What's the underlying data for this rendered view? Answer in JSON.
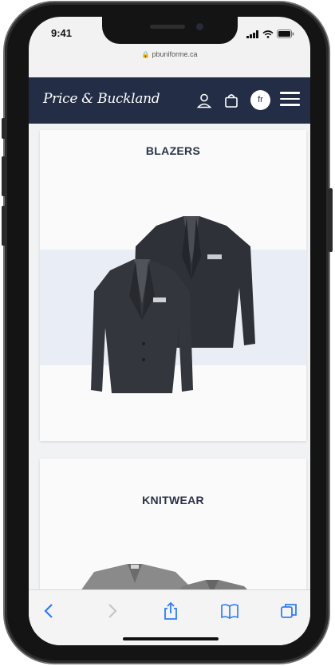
{
  "status_bar": {
    "time": "9:41"
  },
  "browser": {
    "url": "pbuniforme.ca"
  },
  "site_header": {
    "logo_text": "Price & Buckland",
    "language_label": "fr"
  },
  "categories": [
    {
      "title": "BLAZERS"
    },
    {
      "title": "KNITWEAR"
    }
  ],
  "colors": {
    "header_bg": "#232d46",
    "accent_band": "#e9edf5",
    "garment": "#2f3238",
    "knit": "#8c8c8c",
    "link_blue": "#2f7df6"
  },
  "toolbar": {
    "items": [
      "back-icon",
      "forward-icon",
      "share-icon",
      "bookmarks-icon",
      "tabs-icon"
    ]
  }
}
